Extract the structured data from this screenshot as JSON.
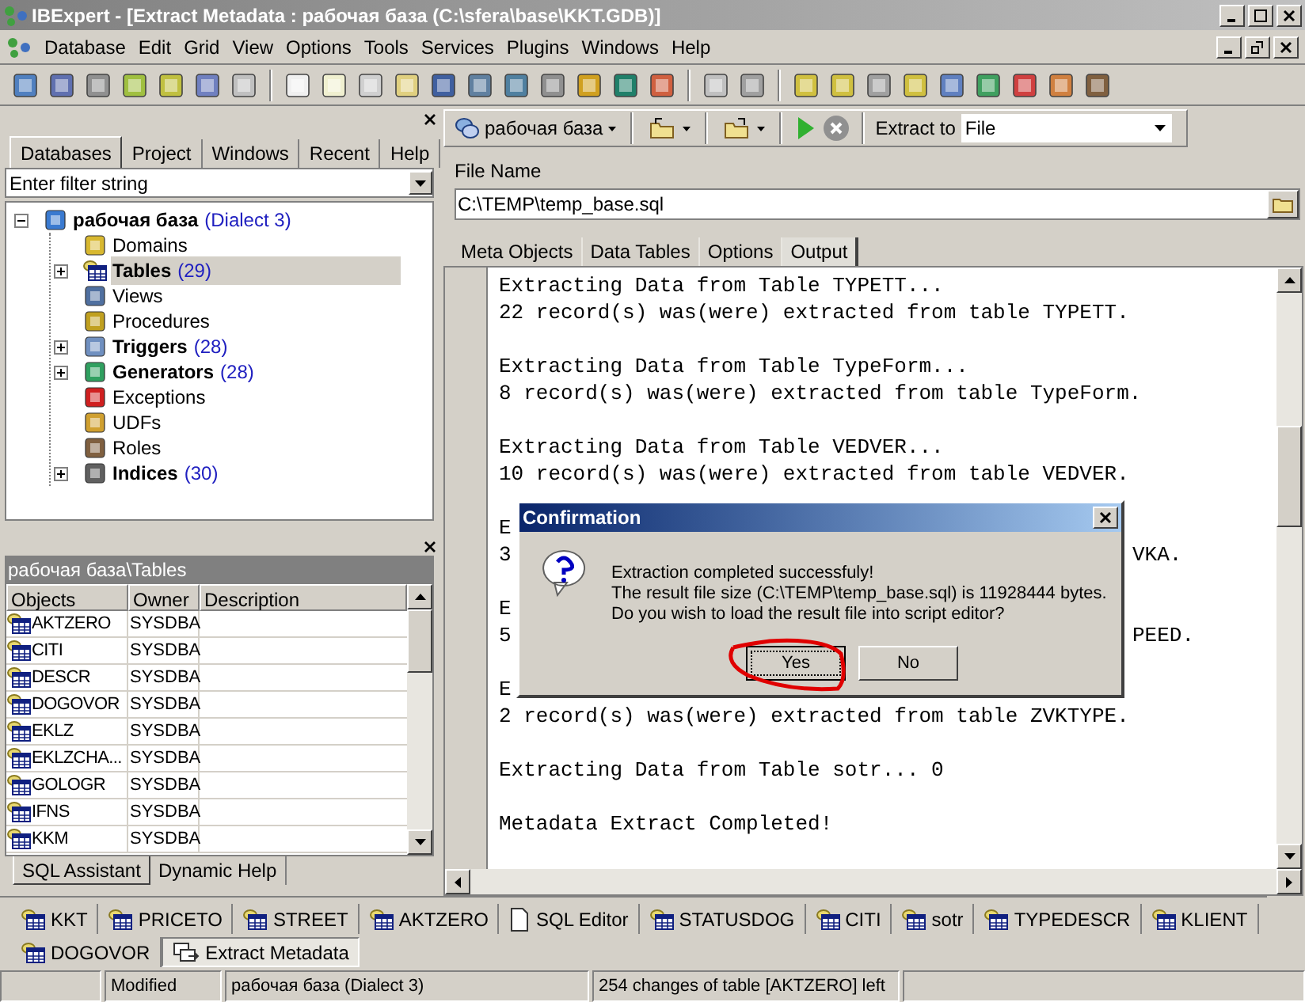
{
  "window": {
    "title": "IBExpert - [Extract Metadata : рабочая база (C:\\sfera\\base\\KKT.GDB)]"
  },
  "menu": [
    "Database",
    "Edit",
    "Grid",
    "View",
    "Options",
    "Tools",
    "Services",
    "Plugins",
    "Windows",
    "Help"
  ],
  "left_panel": {
    "tabs": [
      {
        "label": "Databases",
        "selected": true
      },
      {
        "label": "Project",
        "selected": false
      },
      {
        "label": "Windows",
        "selected": false
      },
      {
        "label": "Recent",
        "selected": false
      },
      {
        "label": "Help",
        "selected": false
      }
    ],
    "filter": {
      "value": "Enter filter string"
    },
    "tree": [
      {
        "label": "рабочая база",
        "count": "(Dialect 3)",
        "kind": "database",
        "expanded": true,
        "selected": false,
        "children": [
          {
            "label": "Domains",
            "kind": "domains",
            "selected": false
          },
          {
            "label": "Tables",
            "count": "(29)",
            "kind": "tables",
            "expanded": false,
            "selected": true
          },
          {
            "label": "Views",
            "kind": "views",
            "selected": false
          },
          {
            "label": "Procedures",
            "kind": "procedures",
            "selected": false
          },
          {
            "label": "Triggers",
            "count": "(28)",
            "kind": "triggers",
            "expanded": false,
            "selected": false
          },
          {
            "label": "Generators",
            "count": "(28)",
            "kind": "generators",
            "expanded": false,
            "selected": false
          },
          {
            "label": "Exceptions",
            "kind": "exceptions",
            "selected": false
          },
          {
            "label": "UDFs",
            "kind": "udfs",
            "selected": false
          },
          {
            "label": "Roles",
            "kind": "roles",
            "selected": false
          },
          {
            "label": "Indices",
            "count": "(30)",
            "kind": "indices",
            "expanded": false,
            "selected": false
          }
        ]
      }
    ]
  },
  "objects_panel": {
    "title": "рабочая база\\Tables",
    "columns": [
      "Objects",
      "Owner",
      "Description"
    ],
    "rows": [
      {
        "name": "AKTZERO",
        "owner": "SYSDBA"
      },
      {
        "name": "CITI",
        "owner": "SYSDBA"
      },
      {
        "name": "DESCR",
        "owner": "SYSDBA"
      },
      {
        "name": "DOGOVOR",
        "owner": "SYSDBA"
      },
      {
        "name": "EKLZ",
        "owner": "SYSDBA"
      },
      {
        "name": "EKLZCHA...",
        "owner": "SYSDBA"
      },
      {
        "name": "GOLOGR",
        "owner": "SYSDBA"
      },
      {
        "name": "IFNS",
        "owner": "SYSDBA"
      },
      {
        "name": "KKM",
        "owner": "SYSDBA"
      }
    ],
    "tabs": [
      {
        "label": "SQL Assistant",
        "selected": true
      },
      {
        "label": "Dynamic Help",
        "selected": false
      }
    ]
  },
  "extract_toolbar": {
    "database": "рабочая база",
    "extract_to_label": "Extract to",
    "extract_to": "File"
  },
  "file_name": {
    "label": "File Name",
    "value": "C:\\TEMP\\temp_base.sql"
  },
  "tabs": [
    {
      "label": "Meta Objects",
      "selected": false
    },
    {
      "label": "Data Tables",
      "selected": false
    },
    {
      "label": "Options",
      "selected": false
    },
    {
      "label": "Output",
      "selected": true
    }
  ],
  "output": {
    "blocks": [
      {
        "lines": [
          {
            "text": "Extracting Data from Table TYPETT..."
          },
          {
            "text": "22 record(s) was(were) extracted from table TYPETT."
          }
        ]
      },
      {
        "lines": [
          {
            "text": "Extracting Data from Table TypeForm..."
          },
          {
            "text": "8 record(s) was(were) extracted from table TypeForm."
          }
        ]
      },
      {
        "lines": [
          {
            "text": "Extracting Data from Table VEDVER..."
          },
          {
            "text": "10 record(s) was(were) extracted from table VEDVER."
          }
        ]
      },
      {
        "lines": [
          {
            "text": "E"
          },
          {
            "text": "3",
            "end": "VKA."
          }
        ]
      },
      {
        "lines": [
          {
            "text": "E"
          },
          {
            "text": "5",
            "end": "PEED."
          }
        ]
      },
      {
        "lines": [
          {
            "text": "E"
          },
          {
            "text": "2 record(s) was(were) extracted from table ZVKTYPE."
          }
        ]
      },
      {
        "lines": [
          {
            "text": "Extracting Data from Table sotr... 0"
          }
        ]
      },
      {
        "lines": [
          {
            "text": "Metadata Extract Completed!"
          }
        ]
      }
    ]
  },
  "dialog": {
    "title": "Confirmation",
    "message": [
      "Extraction completed successfuly!",
      "The result file size (C:\\TEMP\\temp_base.sql) is 11928444 bytes.",
      "Do you wish to load the result file into script editor?"
    ],
    "buttons": [
      {
        "label": "Yes",
        "focused": true,
        "circled": true
      },
      {
        "label": "No",
        "focused": false,
        "circled": false
      }
    ]
  },
  "window_tabs": [
    {
      "label": "KKT",
      "kind": "table",
      "selected": false
    },
    {
      "label": "PRICETO",
      "kind": "table",
      "selected": false
    },
    {
      "label": "STREET",
      "kind": "table",
      "selected": false
    },
    {
      "label": "AKTZERO",
      "kind": "table",
      "selected": false
    },
    {
      "label": "SQL Editor",
      "kind": "editor",
      "selected": false
    },
    {
      "label": "STATUSDOG",
      "kind": "table",
      "selected": false
    },
    {
      "label": "CITI",
      "kind": "table",
      "selected": false
    },
    {
      "label": "sotr",
      "kind": "table",
      "selected": false
    },
    {
      "label": "TYPEDESCR",
      "kind": "table",
      "selected": false
    },
    {
      "label": "KLIENT",
      "kind": "table",
      "selected": false
    },
    {
      "label": "DOGOVOR",
      "kind": "table",
      "selected": false
    },
    {
      "label": "Extract Metadata",
      "kind": "extract",
      "selected": true
    }
  ],
  "status_bar": [
    "Modified",
    "рабочая база (Dialect 3)",
    "254 changes of table [AKTZERO] left"
  ]
}
